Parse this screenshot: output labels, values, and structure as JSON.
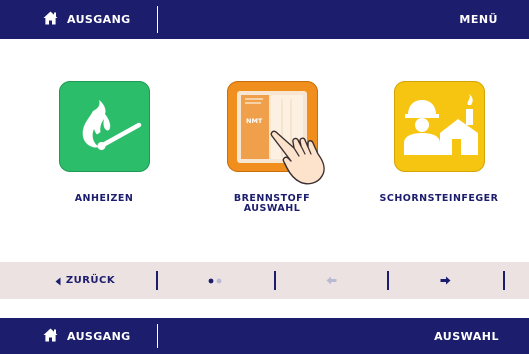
{
  "header": {
    "home_label": "AUSGANG",
    "menu_label": "MENÜ"
  },
  "tiles": [
    {
      "label": "ANHEIZEN",
      "icon": "flame-match-icon",
      "color": "#2cbd6a"
    },
    {
      "label_line1": "BRENNSTOFF",
      "label_line2": "AUSWAHL",
      "icon": "fuel-book-icon",
      "badge": "NMT",
      "color": "#f08f1e"
    },
    {
      "label": "SCHORNSTEINFEGER",
      "icon": "chimney-sweep-icon",
      "color": "#f5c511"
    }
  ],
  "nav": {
    "back_label": "ZURÜCK",
    "page_indicator": {
      "current": 1,
      "total": 2
    },
    "prev_icon": "arrow-left-icon",
    "next_icon": "arrow-right-icon"
  },
  "footer": {
    "home_label": "AUSGANG",
    "right_label": "AUSWAHL"
  },
  "colors": {
    "navy": "#1d1d6e",
    "nav_bg": "#ece2e2",
    "green": "#2cbd6a",
    "orange": "#f08f1e",
    "yellow": "#f5c511"
  }
}
